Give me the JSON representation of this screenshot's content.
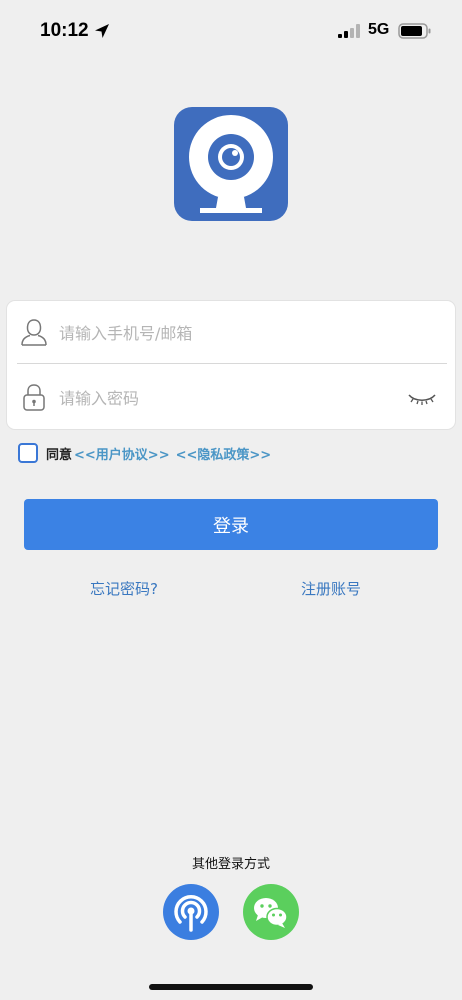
{
  "status_bar": {
    "time": "10:12",
    "network": "5G",
    "icons": [
      "location-arrow-icon",
      "signal-icon",
      "battery-icon"
    ]
  },
  "app": {
    "logo_icon": "webcam-icon",
    "accent_color": "#3b82e4",
    "logo_color": "#3f6dbe"
  },
  "login_form": {
    "phone_placeholder": "请输入手机号/邮箱",
    "password_placeholder": "请输入密码",
    "phone_icon": "user-icon",
    "password_icon": "lock-icon",
    "visibility_icon": "eye-closed-icon"
  },
  "agreement": {
    "checked": false,
    "prefix": "同意",
    "user_agreement": "<<用户协议>>",
    "privacy_policy": "<<隐私政策>>"
  },
  "actions": {
    "login_label": "登录",
    "forgot_password": "忘记密码?",
    "register": "注册账号"
  },
  "other_login": {
    "title": "其他登录方式",
    "methods": [
      {
        "icon": "broadcast-icon",
        "color": "#3b7ee0"
      },
      {
        "icon": "wechat-icon",
        "color": "#5bcf5d"
      }
    ]
  }
}
